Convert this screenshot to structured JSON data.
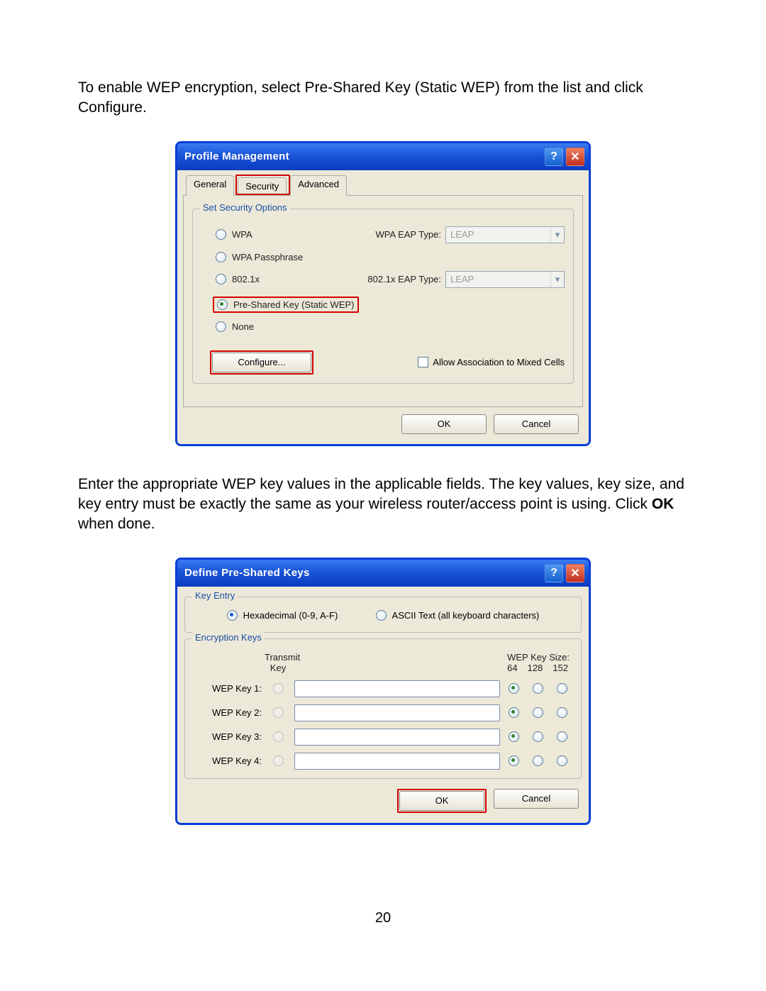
{
  "doc": {
    "para1": "To enable WEP encryption, select Pre-Shared Key (Static WEP) from the list and click Configure.",
    "para2_a": "Enter the appropriate WEP key values in the applicable fields. The key values, key size, and key entry must be exactly the same as your wireless router/access point is using. Click ",
    "para2_b": "OK",
    "para2_c": " when done.",
    "page_number": "20"
  },
  "dialog1": {
    "title": "Profile Management",
    "tabs": {
      "general": "General",
      "security": "Security",
      "advanced": "Advanced"
    },
    "group_title": "Set Security Options",
    "opt_wpa": "WPA",
    "opt_wpa_pass": "WPA Passphrase",
    "opt_8021x": "802.1x",
    "opt_psk": "Pre-Shared Key (Static WEP)",
    "opt_none": "None",
    "wpa_eap_label": "WPA EAP Type:",
    "x_eap_label": "802.1x EAP Type:",
    "eap_value": "LEAP",
    "configure": "Configure...",
    "allow_mixed": "Allow Association to Mixed Cells",
    "ok": "OK",
    "cancel": "Cancel"
  },
  "dialog2": {
    "title": "Define Pre-Shared Keys",
    "key_entry": "Key Entry",
    "hex": "Hexadecimal (0-9, A-F)",
    "ascii": "ASCII Text (all keyboard characters)",
    "enc_keys": "Encryption Keys",
    "transmit": "Transmit",
    "transmit2": "Key",
    "wep_size": "WEP Key Size:",
    "size64": "64",
    "size128": "128",
    "size152": "152",
    "k1": "WEP Key 1:",
    "k2": "WEP Key 2:",
    "k3": "WEP Key 3:",
    "k4": "WEP Key 4:",
    "ok": "OK",
    "cancel": "Cancel"
  }
}
